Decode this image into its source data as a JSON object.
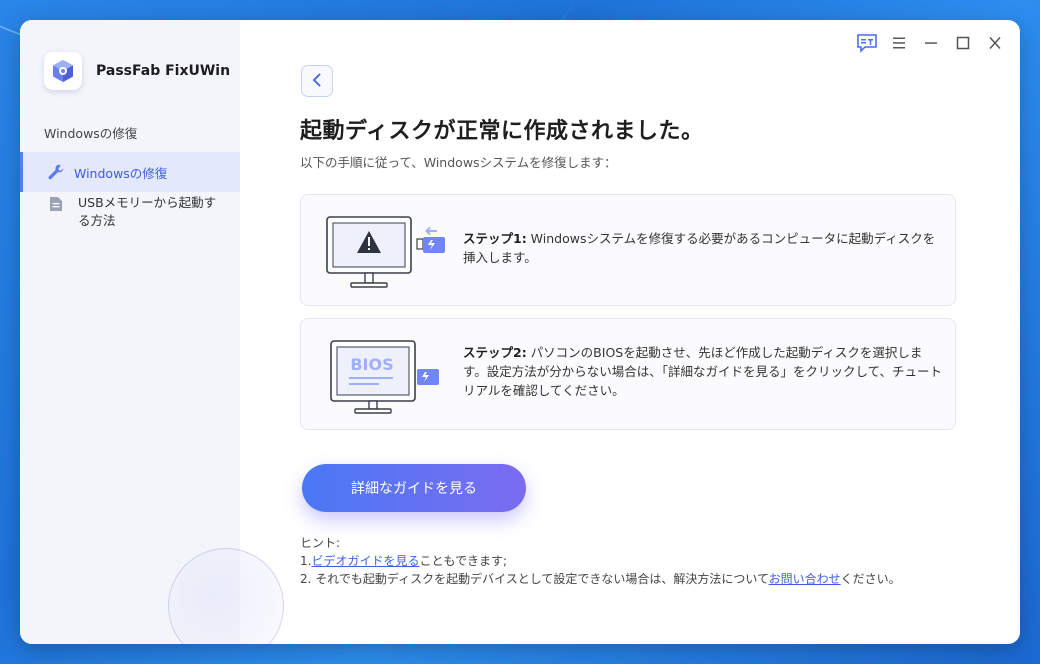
{
  "app": {
    "name": "PassFab FixUWin"
  },
  "sidebar": {
    "section_label": "Windowsの修復",
    "items": [
      {
        "label": "Windowsの修復",
        "icon": "wrench-icon",
        "active": true
      },
      {
        "label": "USBメモリーから起動する方法",
        "icon": "document-icon",
        "active": false
      }
    ]
  },
  "titlebar": {
    "icons": [
      "feedback-icon",
      "menu-icon",
      "minimize-icon",
      "maximize-icon",
      "close-icon"
    ]
  },
  "main": {
    "title": "起動ディスクが正常に作成されました。",
    "subtitle": "以下の手順に従って、Windowsシステムを修復します：",
    "steps": [
      {
        "label": "ステップ1:",
        "text": " Windowsシステムを修復する必要があるコンピュータに起動ディスクを挿入します。",
        "illustration": "monitor-warning-usb"
      },
      {
        "label": "ステップ2:",
        "text": " パソコンのBIOSを起動させ、先ほど作成した起動ディスクを選択します。設定方法が分からない場合は、「詳細なガイドを見る」をクリックして、チュートリアルを確認してください。",
        "illustration": "monitor-bios-usb",
        "bios_text": "BIOS"
      }
    ],
    "guide_button": "詳細なガイドを見る",
    "hints": {
      "heading": "ヒント:",
      "line1_prefix": "1.",
      "line1_link": "ビデオガイドを見る",
      "line1_suffix": "こともできます;",
      "line2_prefix": "2. それでも起動ディスクを起動デバイスとして設定できない場合は、解決方法について",
      "line2_link": "お問い合わせ",
      "line2_suffix": "ください。"
    }
  },
  "colors": {
    "accent": "#5b7cf2",
    "button_start": "#4a78f5",
    "button_end": "#7b6cf0",
    "desktop": "#2a86e8"
  }
}
